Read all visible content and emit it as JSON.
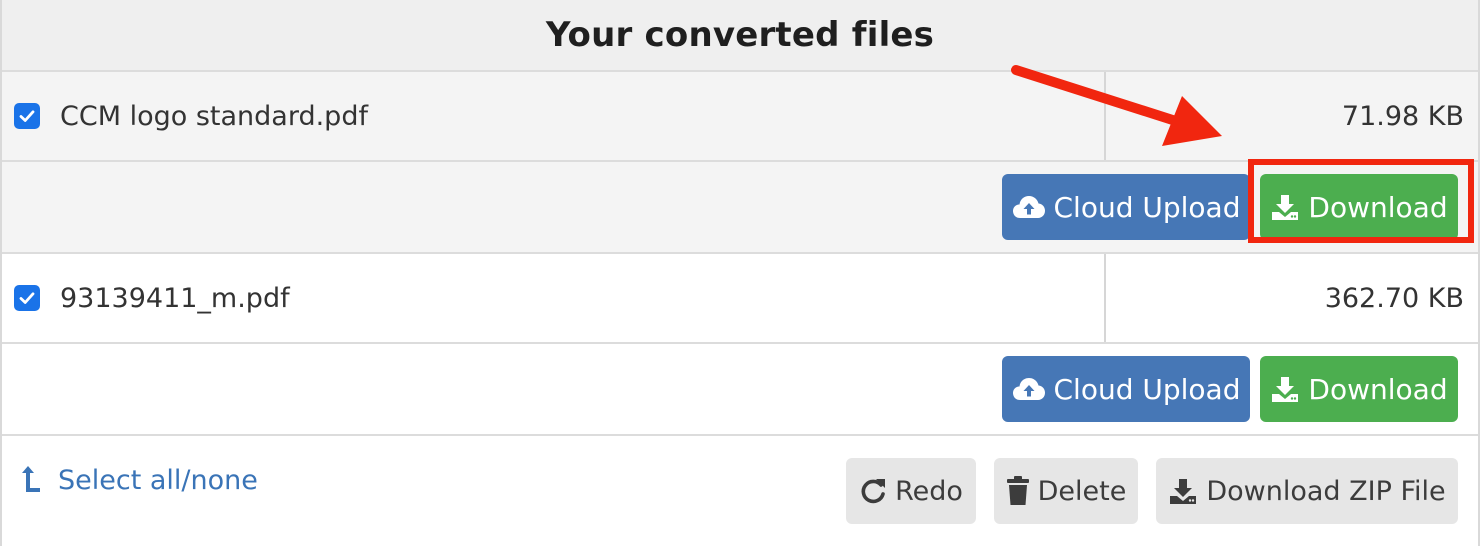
{
  "header": {
    "title": "Your converted files"
  },
  "files": [
    {
      "name": "CCM logo standard.pdf",
      "size": "71.98 KB",
      "checked": true,
      "cloud_upload_label": "Cloud Upload",
      "download_label": "Download",
      "highlighted": true
    },
    {
      "name": "93139411_m.pdf",
      "size": "362.70 KB",
      "checked": true,
      "cloud_upload_label": "Cloud Upload",
      "download_label": "Download",
      "highlighted": false
    }
  ],
  "footer": {
    "select_all_label": "Select all/none",
    "redo_label": "Redo",
    "delete_label": "Delete",
    "download_zip_label": "Download ZIP File"
  },
  "colors": {
    "primary_blue": "#4677b6",
    "success_green": "#4cae4f",
    "checkbox_blue": "#1a73e8",
    "annotation_red": "#f1260f",
    "link_blue": "#3a74b7"
  },
  "icons": [
    "check-icon",
    "cloud-upload-icon",
    "download-icon",
    "redo-icon",
    "trash-icon",
    "select-arrow-icon",
    "annotation-arrow-icon"
  ]
}
